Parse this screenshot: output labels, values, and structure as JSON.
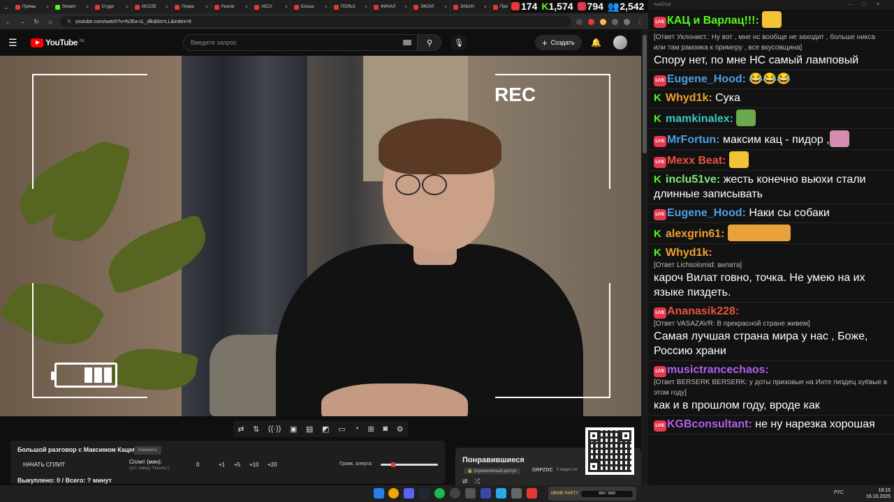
{
  "browser": {
    "tabs": [
      {
        "label": "Прямы",
        "color": "#e53935"
      },
      {
        "label": "Stream",
        "color": "#53fc18"
      },
      {
        "label": "Студи",
        "color": "#e53935"
      },
      {
        "label": "ИССЛЕ",
        "color": "#e53935"
      },
      {
        "label": "Понра",
        "color": "#e53935"
      },
      {
        "label": "Разгов",
        "color": "#e53935"
      },
      {
        "label": "ХЕСУ",
        "color": "#e53935"
      },
      {
        "label": "Больш",
        "color": "#e53935"
      },
      {
        "label": "ПОЛЬЗ",
        "color": "#e53935"
      },
      {
        "label": "ФИНАЛ",
        "color": "#e53935"
      },
      {
        "label": "ЭКСКЛ",
        "color": "#e53935"
      },
      {
        "label": "ЗАБАН",
        "color": "#e53935"
      },
      {
        "label": "Пре",
        "color": "#e53935"
      }
    ],
    "url": "youtube.com/watch?v=NJEa-cL_dlk&list=LL&index=6"
  },
  "youtube": {
    "logo_text": "YouTube",
    "logo_country": "NL",
    "search_placeholder": "Введите запрос",
    "create_label": "Создать"
  },
  "video": {
    "rec_label": "REC",
    "battery_cells": 3
  },
  "overlay": {
    "title": "Большой разговор с Максимом Кацем",
    "badge": "Изменить",
    "start_split": "НАЧАТЬ СПЛИТ",
    "split_label": "Сплит (мин):",
    "split_sub": "(уст. перед \"Начать\")",
    "split_value": "0",
    "increments": [
      "+1",
      "+5",
      "+10",
      "+20"
    ],
    "volume_label": "Громк. алерта:",
    "volume_level": 0.2,
    "total": "Выкуплено: 0 / Всего: ? минут"
  },
  "playlist": {
    "title": "Понравившиеся",
    "access": "Ограниченный доступ",
    "owner": "GRPZDC",
    "count": "5 видео из"
  },
  "stats": {
    "youtube": "174",
    "kick": "1,574",
    "vk": "794",
    "total": "2,542"
  },
  "chat": {
    "window_title": "AxelChat",
    "messages": [
      {
        "platform": "live",
        "user": "КАЦ и Варлац!!!:",
        "color": "#53fc18",
        "reply": "",
        "text": ""
      },
      {
        "platform": "none",
        "user": "",
        "color": "#ffffff",
        "reply": "[Ответ Уклонист.: Ну вот , мне нс вообще не заходит , больше никса или там рамзика к примеру , все вкусовщина]",
        "text": "Спору нет, по мне НС самый ламповый"
      },
      {
        "platform": "live",
        "user": "Eugene_Hood:",
        "color": "#4f9fe0",
        "reply": "",
        "text": "😂😂😂"
      },
      {
        "platform": "kick",
        "user": "Whyd1k:",
        "color": "#f0a030",
        "reply": "",
        "text": "Сука"
      },
      {
        "platform": "kick",
        "user": "mamkinalex:",
        "color": "#3cc8c0",
        "reply": "",
        "text": ""
      },
      {
        "platform": "live",
        "user": "MrFortun:",
        "color": "#4f9fe0",
        "reply": "",
        "text": "максим кац - пидор ,"
      },
      {
        "platform": "live",
        "user": "Mexx Beat:",
        "color": "#e8533c",
        "reply": "",
        "text": ""
      },
      {
        "platform": "kick",
        "user": "inclu51ve:",
        "color": "#7be87b",
        "reply": "",
        "text": "жесть конечно вьюхи стали длинные записывать"
      },
      {
        "platform": "live",
        "user": "Eugene_Hood:",
        "color": "#4f9fe0",
        "reply": "",
        "text": "Наки сы собаки"
      },
      {
        "platform": "kick",
        "user": "alexgrin61:",
        "color": "#f0a030",
        "reply": "",
        "text": ""
      },
      {
        "platform": "kick",
        "user": "Whyd1k:",
        "color": "#f0a030",
        "reply": "[Ответ Lichsolomid: вилата]",
        "text": "кароч Вилат говно, точка. Не умею на их языке пиздеть."
      },
      {
        "platform": "live",
        "user": "Ananasik228:",
        "color": "#e8533c",
        "reply": "[Ответ VASAZAVR: В прекрасной стране живем]",
        "text": "Самая лучшая страна мира у нас , Боже, Россию храни"
      },
      {
        "platform": "live",
        "user": "musictrancechaos:",
        "color": "#b060f0",
        "reply": "[Ответ BERSERK BERSERK: у доты призовые на Инте пиздец хуёвые в этом году]",
        "text": "как и в прошлом году, вроде как"
      },
      {
        "platform": "live",
        "user": "KGBconsultant:",
        "color": "#b060f0",
        "reply": "",
        "text": "не ну нарезка хорошая"
      }
    ]
  },
  "taskbar": {
    "widget_label": "MEME PARTY",
    "widget_bar": "550 / 1500",
    "lang": "РУС",
    "time": "18:15",
    "date": "16.10.2025"
  },
  "colors": {
    "youtube_red": "#ff0000",
    "kick_green": "#53fc18",
    "live_badge": "#e53950"
  }
}
